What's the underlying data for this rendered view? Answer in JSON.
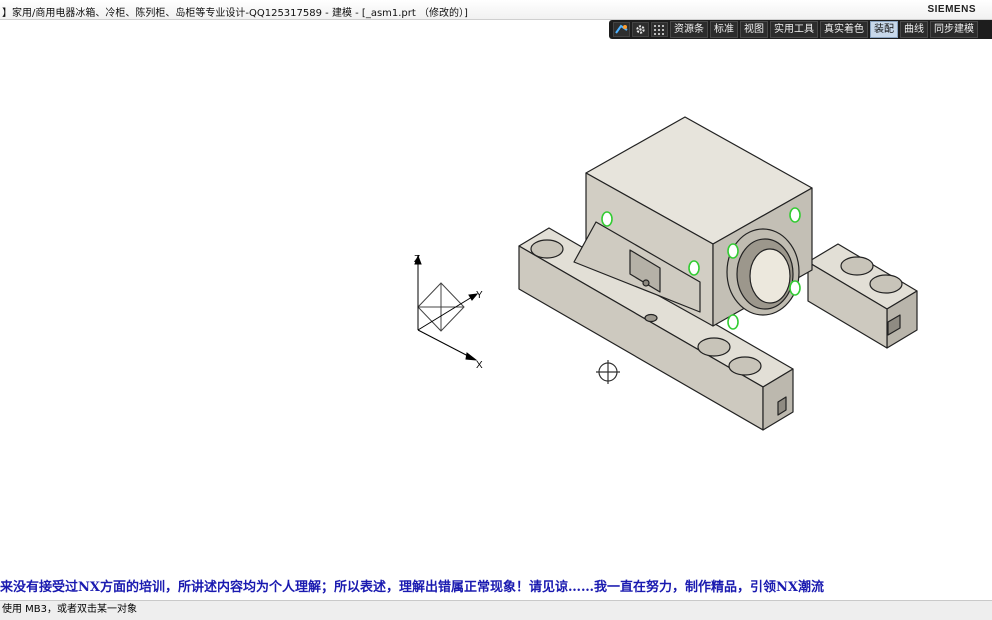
{
  "window": {
    "title": "】家用/商用电器冰箱、冷柜、陈列柜、岛柜等专业设计-QQ125317589 - 建模 - [_asm1.prt （修改的）]",
    "brand": "SIEMENS"
  },
  "ribbon": {
    "icons": [
      "nx-logo-icon",
      "gear-icon",
      "grid-icon"
    ],
    "tabs": [
      {
        "label": "资源条",
        "active": false
      },
      {
        "label": "标准",
        "active": false
      },
      {
        "label": "视图",
        "active": false
      },
      {
        "label": "实用工具",
        "active": false
      },
      {
        "label": "真实着色",
        "active": false
      },
      {
        "label": "装配",
        "active": true
      },
      {
        "label": "曲线",
        "active": false
      },
      {
        "label": "同步建模",
        "active": false
      }
    ]
  },
  "triad": {
    "x": "X",
    "y": "Y",
    "z": "Z"
  },
  "scrolling_note": "来没有接受过NX方面的培训，所讲述内容均为个人理解；所以表述，理解出错属正常现象！请见谅……我一直在努力，制作精品，引领NX潮流",
  "status": "使用 MB3，或者双击某一对象",
  "colors": {
    "ribbon_bg": "#1d1d1d",
    "part_face": "#d8d4c9",
    "hole_highlight": "#33cc33",
    "note_text": "#1a1ab0"
  }
}
